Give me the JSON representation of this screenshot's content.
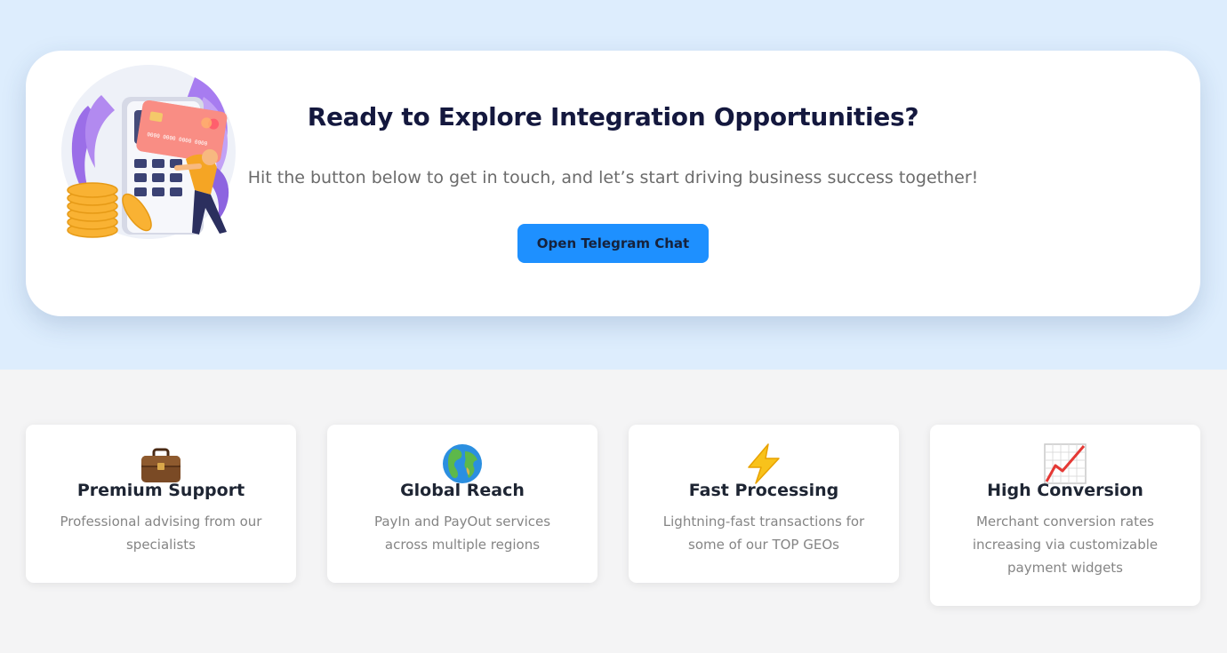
{
  "cta": {
    "title": "Ready to Explore Integration Opportunities?",
    "subtitle": "Hit the button below to get in touch, and let’s start driving business success together!",
    "button_label": "Open Telegram Chat",
    "illustration": "payment-terminal-illustration",
    "card_number": "0000 0000 0000 0000"
  },
  "features": [
    {
      "icon": "briefcase-icon",
      "title": "Premium Support",
      "description": "Professional advising from our specialists"
    },
    {
      "icon": "globe-icon",
      "title": "Global Reach",
      "description": "PayIn and PayOut services across multiple regions"
    },
    {
      "icon": "lightning-icon",
      "title": "Fast Processing",
      "description": "Lightning-fast transactions for some of our TOP GEOs"
    },
    {
      "icon": "chart-increasing-icon",
      "title": "High Conversion",
      "description": "Merchant conversion rates increasing via customizable payment widgets"
    }
  ],
  "colors": {
    "top_background": "#ddedfd",
    "bottom_background": "#f4f4f5",
    "button": "#1e90ff",
    "title": "#14183e"
  }
}
